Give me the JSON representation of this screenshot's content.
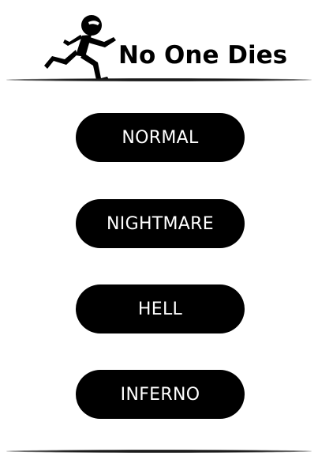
{
  "header": {
    "title": "No One Dies",
    "logo_icon": "running-stick-figure-icon"
  },
  "menu": {
    "items": [
      {
        "label": "NORMAL"
      },
      {
        "label": "NIGHTMARE"
      },
      {
        "label": "HELL"
      },
      {
        "label": "INFERNO"
      }
    ]
  },
  "colors": {
    "background": "#ffffff",
    "button": "#000000",
    "button_text": "#ffffff",
    "title_text": "#000000"
  }
}
